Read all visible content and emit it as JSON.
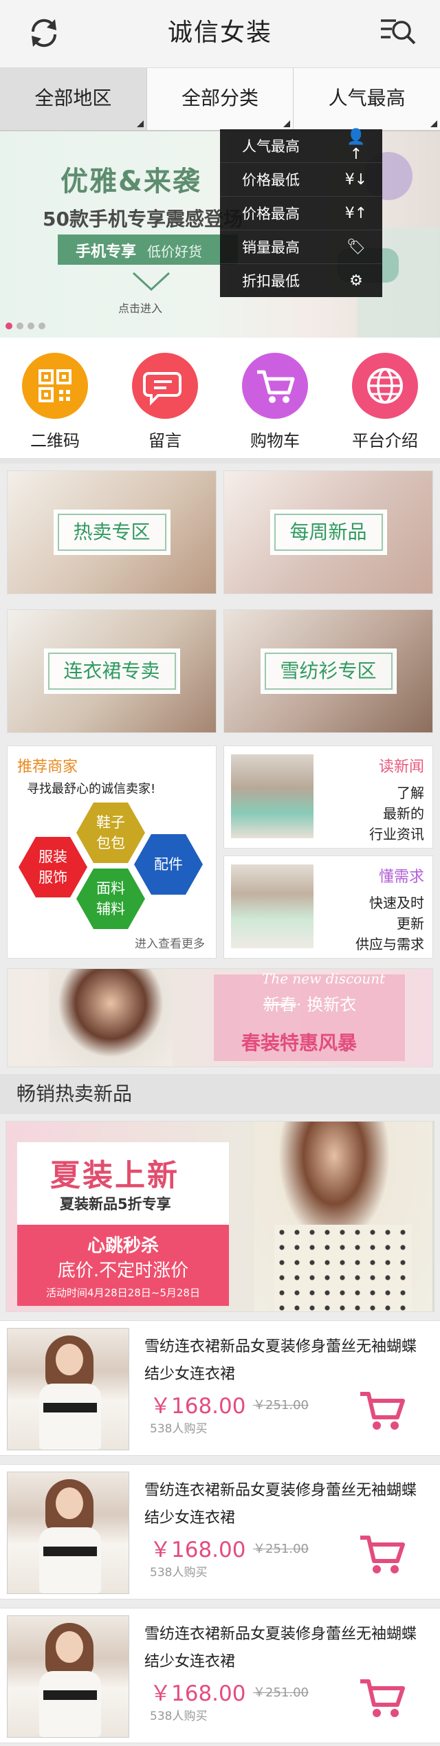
{
  "header": {
    "title": "诚信女装",
    "refresh_icon": "refresh-icon",
    "menu_icon": "search-list-icon"
  },
  "filters": {
    "region": "全部地区",
    "category": "全部分类",
    "sort": "人气最高"
  },
  "banner": {
    "headline": "优雅&来袭",
    "subline": "50款手机专享震感登场",
    "tag_bold": "手机专享",
    "tag_light": "低价好货",
    "enter": "点击进入"
  },
  "sort_menu": {
    "items": [
      {
        "label": "人气最高",
        "icon": "person-up-icon",
        "glyph": "👤↑"
      },
      {
        "label": "价格最低",
        "icon": "yen-down-icon",
        "glyph": "¥↓"
      },
      {
        "label": "价格最高",
        "icon": "yen-up-icon",
        "glyph": "¥↑"
      },
      {
        "label": "销量最高",
        "icon": "tag-icon",
        "glyph": "🏷"
      },
      {
        "label": "折扣最低",
        "icon": "discount-icon",
        "glyph": "⚙"
      }
    ]
  },
  "quick_menu": {
    "items": [
      {
        "label": "二维码",
        "icon": "qrcode-icon",
        "color": "#f5a00f"
      },
      {
        "label": "留言",
        "icon": "message-icon",
        "color": "#f24d59"
      },
      {
        "label": "购物车",
        "icon": "cart-icon",
        "color": "#cc5fe0"
      },
      {
        "label": "平台介绍",
        "icon": "globe-icon",
        "color": "#f04f79"
      }
    ]
  },
  "tiles": {
    "hot": "热卖专区",
    "weekly": "每周新品",
    "dress": "连衣裙专卖",
    "chiffon": "雪纺衫专区"
  },
  "merchant": {
    "title": "推荐商家",
    "subtitle": "寻找最舒心的诚信卖家!",
    "hex_shoes": "鞋子\n包包",
    "hex_clothes": "服装\n服饰",
    "hex_accessories": "配件",
    "hex_fabric": "面料\n辅料",
    "more": "进入查看更多"
  },
  "news": {
    "title": "读新闻",
    "title_color": "#e85b7e",
    "lines": [
      "了解",
      "最新的",
      "行业资讯"
    ]
  },
  "demand": {
    "title": "懂需求",
    "title_color": "#b25fd6",
    "lines": [
      "快速及时",
      "更新",
      "供应与需求"
    ]
  },
  "spring_banner": {
    "script": "The new discount",
    "old": "新春",
    "new_text": "· 换新衣",
    "big": "春装特惠风暴"
  },
  "section_title": "畅销热卖新品",
  "summer_banner": {
    "title": "夏装上新",
    "subtitle": "夏装新品5折专享",
    "flash": "心跳秒杀",
    "slogan": "底价.不定时涨价",
    "period": "活动时间4月28日28日~5月28日"
  },
  "products": [
    {
      "name": "雪纺连衣裙新品女夏装修身蕾丝无袖蝴蝶结少女连衣裙",
      "price": "￥168.00",
      "old_price": "￥251.00",
      "sold": "538人购买"
    },
    {
      "name": "雪纺连衣裙新品女夏装修身蕾丝无袖蝴蝶结少女连衣裙",
      "price": "￥168.00",
      "old_price": "￥251.00",
      "sold": "538人购买"
    },
    {
      "name": "雪纺连衣裙新品女夏装修身蕾丝无袖蝴蝶结少女连衣裙",
      "price": "￥168.00",
      "old_price": "￥251.00",
      "sold": "538人购买"
    }
  ],
  "colors": {
    "accent_pink": "#e34d7d",
    "accent_green": "#2f9a60"
  }
}
